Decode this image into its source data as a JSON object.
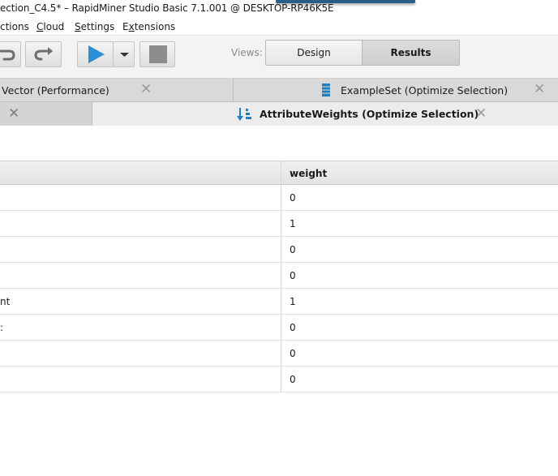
{
  "window": {
    "title": "ection_C4.5* – RapidMiner Studio Basic 7.1.001 @ DESKTOP-RP46K5E"
  },
  "menu": {
    "items": [
      {
        "pre": "",
        "u": "",
        "post": "ctions"
      },
      {
        "pre": "",
        "u": "C",
        "post": "loud"
      },
      {
        "pre": "",
        "u": "S",
        "post": "ettings"
      },
      {
        "pre": "E",
        "u": "x",
        "post": "tensions"
      }
    ]
  },
  "toolbar": {
    "views_label": "Views:",
    "design_label": "Design",
    "results_label": "Results",
    "accent": "#2a8fd6"
  },
  "tabs": {
    "row1": [
      {
        "label": "Vector (Performance)",
        "close": "✕"
      },
      {
        "label": "ExampleSet (Optimize Selection)",
        "close": "✕"
      }
    ],
    "row2": [
      {
        "label": "",
        "close": "✕"
      },
      {
        "label": "AttributeWeights (Optimize Selection)",
        "close": "✕",
        "active": true
      }
    ]
  },
  "table": {
    "columns": [
      "",
      "weight"
    ],
    "rows": [
      {
        "attribute": "",
        "weight": "0"
      },
      {
        "attribute": "",
        "weight": "1"
      },
      {
        "attribute": "",
        "weight": "0"
      },
      {
        "attribute": "",
        "weight": "0"
      },
      {
        "attribute": "nt",
        "weight": "1"
      },
      {
        "attribute": ":",
        "weight": "0"
      },
      {
        "attribute": "",
        "weight": "0"
      },
      {
        "attribute": "",
        "weight": "0"
      }
    ]
  }
}
